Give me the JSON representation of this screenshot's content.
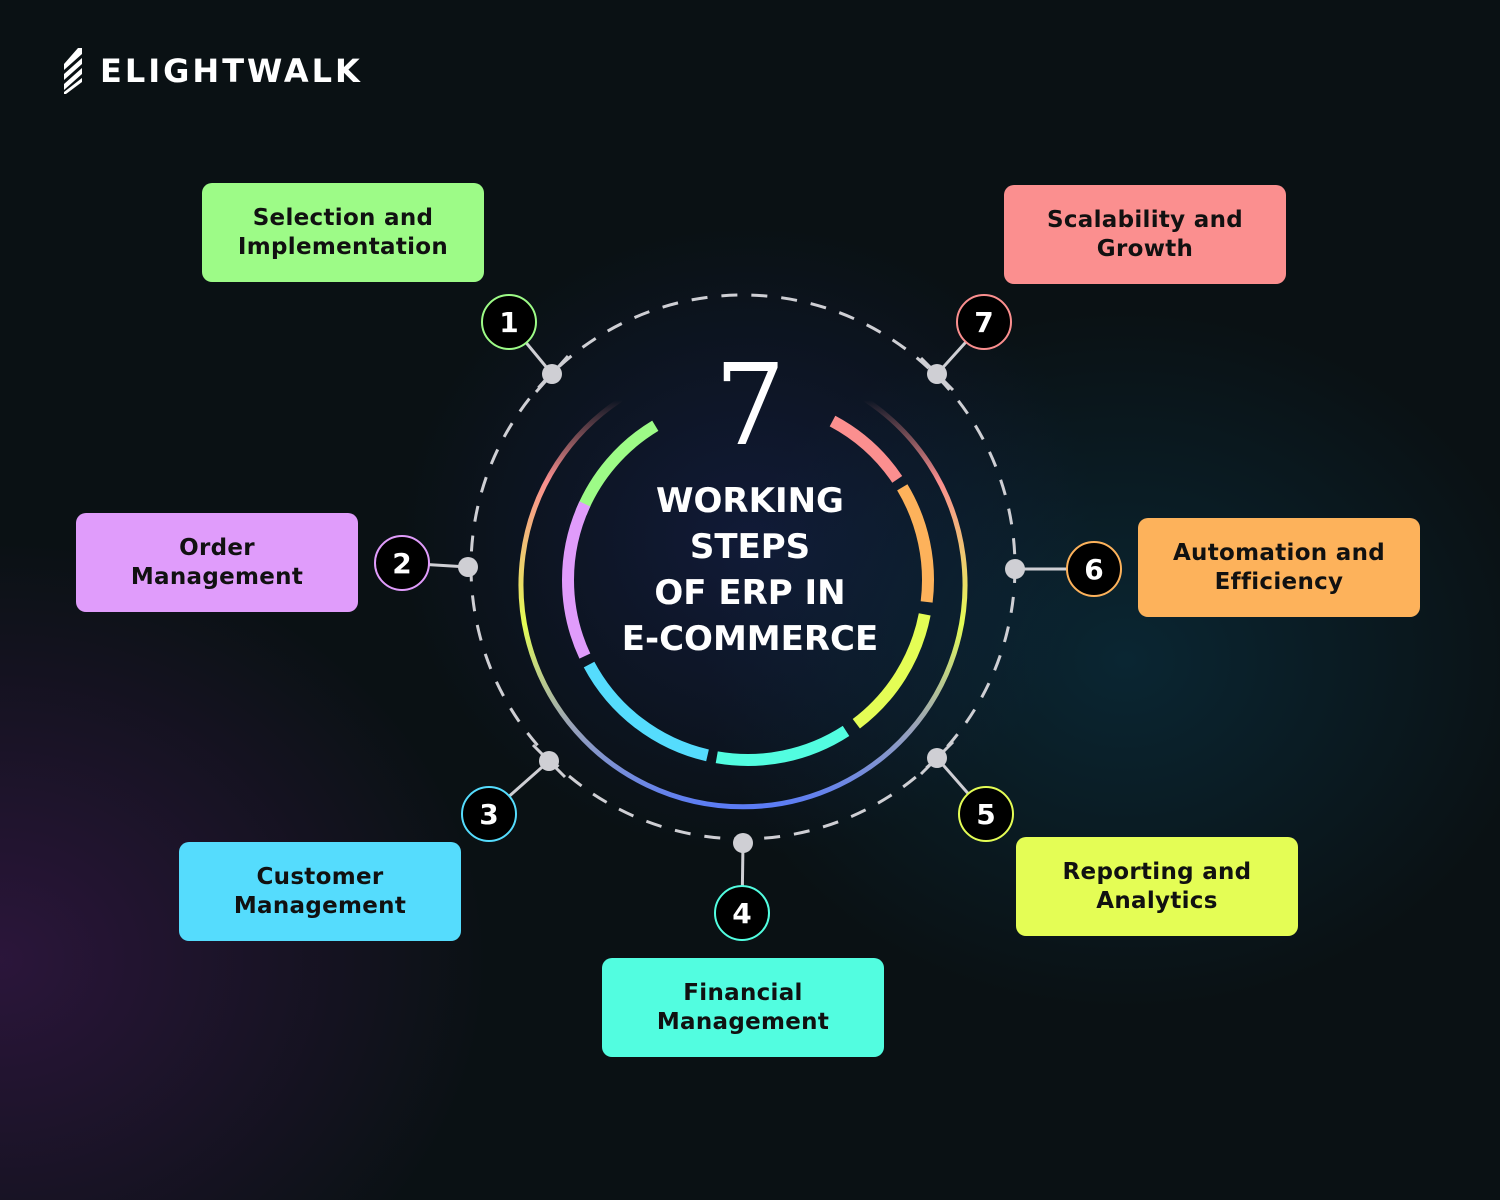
{
  "brand": {
    "name": "ELIGHTWALK",
    "icon": "striped-logo-icon"
  },
  "center": {
    "number": "7",
    "title_lines": [
      "WORKING",
      "STEPS",
      "OF ERP IN",
      "E-COMMERCE"
    ]
  },
  "steps": [
    {
      "number": "1",
      "lines": [
        "Selection and",
        "Implementation"
      ],
      "color": "#9dfb87"
    },
    {
      "number": "2",
      "lines": [
        "Order",
        "Management"
      ],
      "color": "#e09cfb"
    },
    {
      "number": "3",
      "lines": [
        "Customer",
        "Management"
      ],
      "color": "#55dcfd"
    },
    {
      "number": "4",
      "lines": [
        "Financial",
        "Management"
      ],
      "color": "#52fde0"
    },
    {
      "number": "5",
      "lines": [
        "Reporting and",
        "Analytics"
      ],
      "color": "#e4fd55"
    },
    {
      "number": "6",
      "lines": [
        "Automation and",
        "Efficiency"
      ],
      "color": "#fdb25b"
    },
    {
      "number": "7",
      "lines": [
        "Scalability and",
        "Growth"
      ],
      "color": "#fb8f8f"
    }
  ],
  "colors": {
    "connector": "#cfcfd4",
    "background": "#0a1114"
  }
}
